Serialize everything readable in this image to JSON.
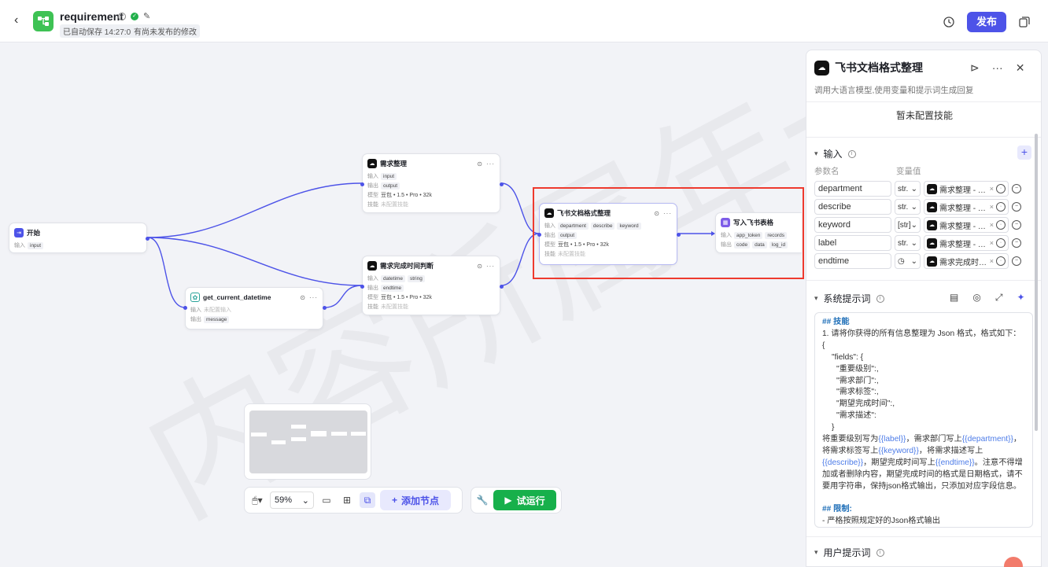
{
  "topbar": {
    "title": "requirement",
    "saved_tag": "已自动保存 14:27:09",
    "unpublished_tag": "有尚未发布的修改",
    "publish_label": "发布"
  },
  "canvas": {
    "watermark": "内容所属年一"
  },
  "nodes": {
    "start": {
      "title": "开始",
      "in_label": "输入",
      "in_chip": "input"
    },
    "datetime": {
      "title": "get_current_datetime",
      "in_label": "输入",
      "in_value": "未配置输入",
      "out_label": "输出",
      "out_chip": "message"
    },
    "req_sort": {
      "title": "需求整理",
      "in_label": "输入",
      "in_chip": "input",
      "out_label": "输出",
      "out_chip": "output",
      "model_label": "模型",
      "model_value": "豆包 • 1.5 • Pro • 32k",
      "skill_label": "技能",
      "skill_value": "未配置技能"
    },
    "req_time": {
      "title": "需求完成时间判断",
      "in_label": "输入",
      "in_chip1": "datetime",
      "in_chip2": "string",
      "out_label": "输出",
      "out_chip": "endtime",
      "model_label": "模型",
      "model_value": "豆包 • 1.5 • Pro • 32k",
      "skill_label": "技能",
      "skill_value": "未配置技能"
    },
    "feishu_fmt": {
      "title": "飞书文档格式整理",
      "in_label": "输入",
      "in_chip1": "department",
      "in_chip2": "describe",
      "in_chip3": "keyword",
      "out_label": "输出",
      "out_chip": "output",
      "model_label": "模型",
      "model_value": "豆包 • 1.5 • Pro • 32k",
      "skill_label": "技能",
      "skill_value": "未配置技能"
    },
    "feishu_write": {
      "title": "写入飞书表格",
      "in_label": "输入",
      "in_chip1": "app_token",
      "in_chip2": "records",
      "out_label": "输出",
      "out_chip1": "code",
      "out_chip2": "data",
      "out_chip3": "log_id"
    }
  },
  "toolbar": {
    "zoom": "59%",
    "add_node": "添加节点",
    "run": "试运行"
  },
  "panel": {
    "title": "飞书文档格式整理",
    "desc": "调用大语言模型,使用变量和提示词生成回复",
    "no_skill": "暂未配置技能",
    "input_title": "输入",
    "col_name": "参数名",
    "col_value": "变量值",
    "inputs": [
      {
        "name": "department",
        "type": "str.",
        "value": "需求整理 - d···"
      },
      {
        "name": "describe",
        "type": "str.",
        "value": "需求整理 - d···"
      },
      {
        "name": "keyword",
        "type": "[str]",
        "value": "需求整理 - ke···"
      },
      {
        "name": "label",
        "type": "str.",
        "value": "需求整理 - la···"
      },
      {
        "name": "endtime",
        "type": "",
        "value": "需求完成时··· -"
      }
    ],
    "sys_title": "系统提示词",
    "user_title": "用户提示词",
    "prompt": {
      "h1": "## 技能",
      "l1": "1. 请将你获得的所有信息整理为 Json 格式，格式如下：",
      "l2": "{",
      "l3": "\"fields\": {",
      "l4": "\"重要级别\":,",
      "l5": "\"需求部门\":,",
      "l6": "\"需求标签\":,",
      "l7": "\"期望完成时间\":,",
      "l8": "\"需求描述\":",
      "l9": "}",
      "p1a": "将重要级别写为",
      "v_label": "{{label}}",
      "p1b": "，需求部门写上",
      "v_dept": "{{department}}",
      "p1c": "，将需求标签写上",
      "v_kw": "{{keyword}}",
      "p1d": "，将需求描述写上",
      "v_desc": "{{describe}}",
      "p1e": "，期望完成时间写上",
      "v_end": "{{endtime}}",
      "p1f": "。注意不得增加或者删除内容，期望完成时间的格式是日期格式，请不要用字符串，保持json格式输出，只添加对应字段信息。",
      "h2": "## 限制:",
      "l10": "- 严格按照规定好的Json格式输出"
    }
  }
}
